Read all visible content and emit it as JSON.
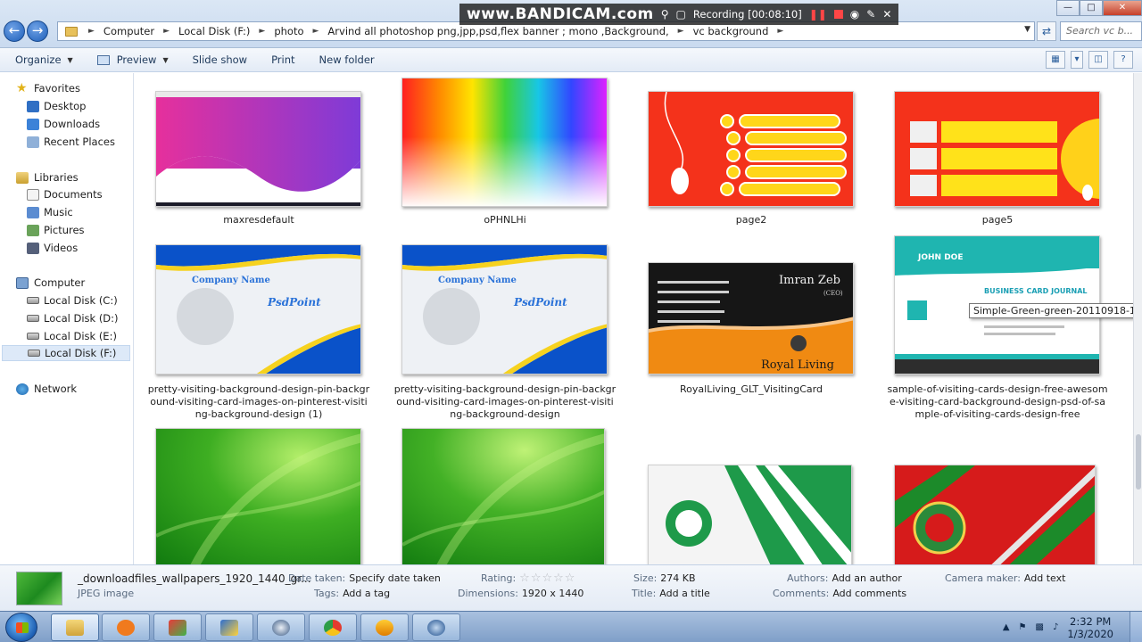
{
  "addressbar": {
    "breadcrumbs": [
      "Computer",
      "Local Disk (F:)",
      "photo",
      "Arvind all photoshop png,jpp,psd,flex banner ; mono ,Background,",
      "vc background"
    ],
    "search_placeholder": "Search vc b..."
  },
  "recorder": {
    "logo": "www.BANDICAM.com",
    "status": "Recording [00:08:10]"
  },
  "toolbar": {
    "organize": "Organize",
    "preview": "Preview",
    "slideshow": "Slide show",
    "print": "Print",
    "new_folder": "New folder"
  },
  "nav": {
    "favorites": {
      "title": "Favorites",
      "items": [
        "Desktop",
        "Downloads",
        "Recent Places"
      ]
    },
    "libraries": {
      "title": "Libraries",
      "items": [
        "Documents",
        "Music",
        "Pictures",
        "Videos"
      ]
    },
    "computer": {
      "title": "Computer",
      "items": [
        "Local Disk (C:)",
        "Local Disk (D:)",
        "Local Disk (E:)",
        "Local Disk (F:)"
      ]
    },
    "network": {
      "title": "Network"
    }
  },
  "files": [
    {
      "name": "maxresdefault",
      "kind": "wave-screenshot"
    },
    {
      "name": "oPHNLHi",
      "kind": "rainbow"
    },
    {
      "name": "page2",
      "kind": "red-list"
    },
    {
      "name": "page5",
      "kind": "red-grid"
    },
    {
      "name": "pretty-visiting-background-design-pin-background-visiting-card-images-on-pinterest-visiting-background-design (1)",
      "kind": "blue-card",
      "card_title": "Company Name",
      "card_brand": "PsdPoint"
    },
    {
      "name": "pretty-visiting-background-design-pin-background-visiting-card-images-on-pinterest-visiting-background-design",
      "kind": "blue-card",
      "card_title": "Company Name",
      "card_brand": "PsdPoint"
    },
    {
      "name": "RoyalLiving_GLT_VisitingCard",
      "kind": "royal-card",
      "card_title": "Imran Zeb",
      "card_sub": "(CEO)",
      "card_brand": "Royal Living"
    },
    {
      "name": "sample-of-visiting-cards-design-free-awesome-visiting-card-background-design-psd-of-sample-of-visiting-cards-design-free",
      "kind": "green-card",
      "card_title": "JOHN DOE",
      "card_brand": "BUSINESS CARD JOURNAL"
    },
    {
      "name": "",
      "kind": "green-wall"
    },
    {
      "name": "",
      "kind": "green-wall"
    },
    {
      "name": "",
      "kind": "ahli"
    },
    {
      "name": "",
      "kind": "ettifaq"
    }
  ],
  "tooltip": "Simple-Green-green-20110918-1...",
  "details": {
    "filename": "_downloadfiles_wallpapers_1920_1440_gr...",
    "filetype": "JPEG image",
    "date_taken_label": "Date taken:",
    "date_taken_value": "Specify date taken",
    "tags_label": "Tags:",
    "tags_value": "Add a tag",
    "rating_label": "Rating:",
    "rating_value": 0,
    "dimensions_label": "Dimensions:",
    "dimensions_value": "1920 x 1440",
    "size_label": "Size:",
    "size_value": "274 KB",
    "title_label": "Title:",
    "title_value": "Add a title",
    "authors_label": "Authors:",
    "authors_value": "Add an author",
    "comments_label": "Comments:",
    "comments_value": "Add comments",
    "camera_label": "Camera maker:",
    "camera_value": "Add text"
  },
  "taskbar": {
    "time": "2:32 PM",
    "date": "1/3/2020"
  }
}
